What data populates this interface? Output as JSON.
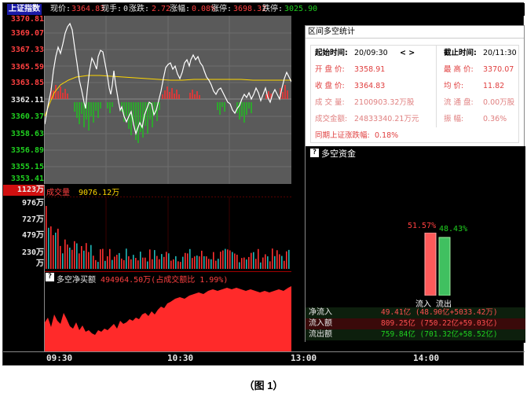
{
  "header": {
    "index_name": "上证指数",
    "price_label": "现价:",
    "price": "3364.83",
    "volume_label": "现手:",
    "volume": "0",
    "change_label": "涨跌:",
    "change": "2.72",
    "pct_label": "涨幅:",
    "pct": "0.08%",
    "limit_up_label": "涨停:",
    "limit_up": "3698.32",
    "limit_down_label": "跌停:",
    "limit_down": "3025.90"
  },
  "price_axis": [
    "3370.81",
    "3369.07",
    "3367.33",
    "3365.59",
    "3363.85",
    "3362.11",
    "3360.37",
    "3358.63",
    "3356.89",
    "3355.15",
    "3353.41"
  ],
  "volume_panel": {
    "label": "成交量",
    "value": "9076.12万",
    "axis": [
      "1123万",
      "976万",
      "727万",
      "479万",
      "230万",
      "万"
    ]
  },
  "flow_panel": {
    "icon": "?",
    "label": "多空净买额",
    "value": "494964.50万(占成交额比 1.99%)"
  },
  "time_axis": [
    "09:30",
    "10:30",
    "13:00",
    "14:00"
  ],
  "dialog": {
    "title": "区间多空统计",
    "start_label": "起始时间:",
    "start_time": "20/09:30",
    "nav": "< >",
    "end_label": "截止时间:",
    "end_time": "20/11:30",
    "open_label": "开 盘 价:",
    "open": "3358.91",
    "high_label": "最 高 价:",
    "high": "3370.07",
    "close_label": "收 盘 价:",
    "close": "3364.83",
    "avg_label": "均   价:",
    "avg": "11.82",
    "vol_label": "成 交 量:",
    "vol": "2100903.32万股",
    "float_label": "流 通 盘:",
    "float": "0.00万股",
    "amount_label": "成交金额:",
    "amount": "24833340.21万元",
    "amp_label": "振   幅:",
    "amp": "0.36%",
    "period_label": "同期上证涨跌幅:",
    "period_value": "0.18%",
    "fund_icon": "?",
    "fund_title": "多空资金",
    "in_pct": "51.57%",
    "out_pct": "48.43%",
    "in_label": "流入",
    "out_label": "流出",
    "rows": [
      {
        "label": "净流入",
        "value": "49.41亿 (48.90亿+5033.42万)"
      },
      {
        "label": "流入额",
        "value": "809.25亿 (750.22亿+59.03亿)"
      },
      {
        "label": "流出额",
        "value": "759.84亿 (701.32亿+58.52亿)"
      }
    ]
  },
  "caption": "（图 1）",
  "colors": {
    "up": "#ff3030",
    "down": "#20c020",
    "bg": "#000000",
    "panel": "#5a5a5a",
    "avg_line": "#ffd700"
  }
}
